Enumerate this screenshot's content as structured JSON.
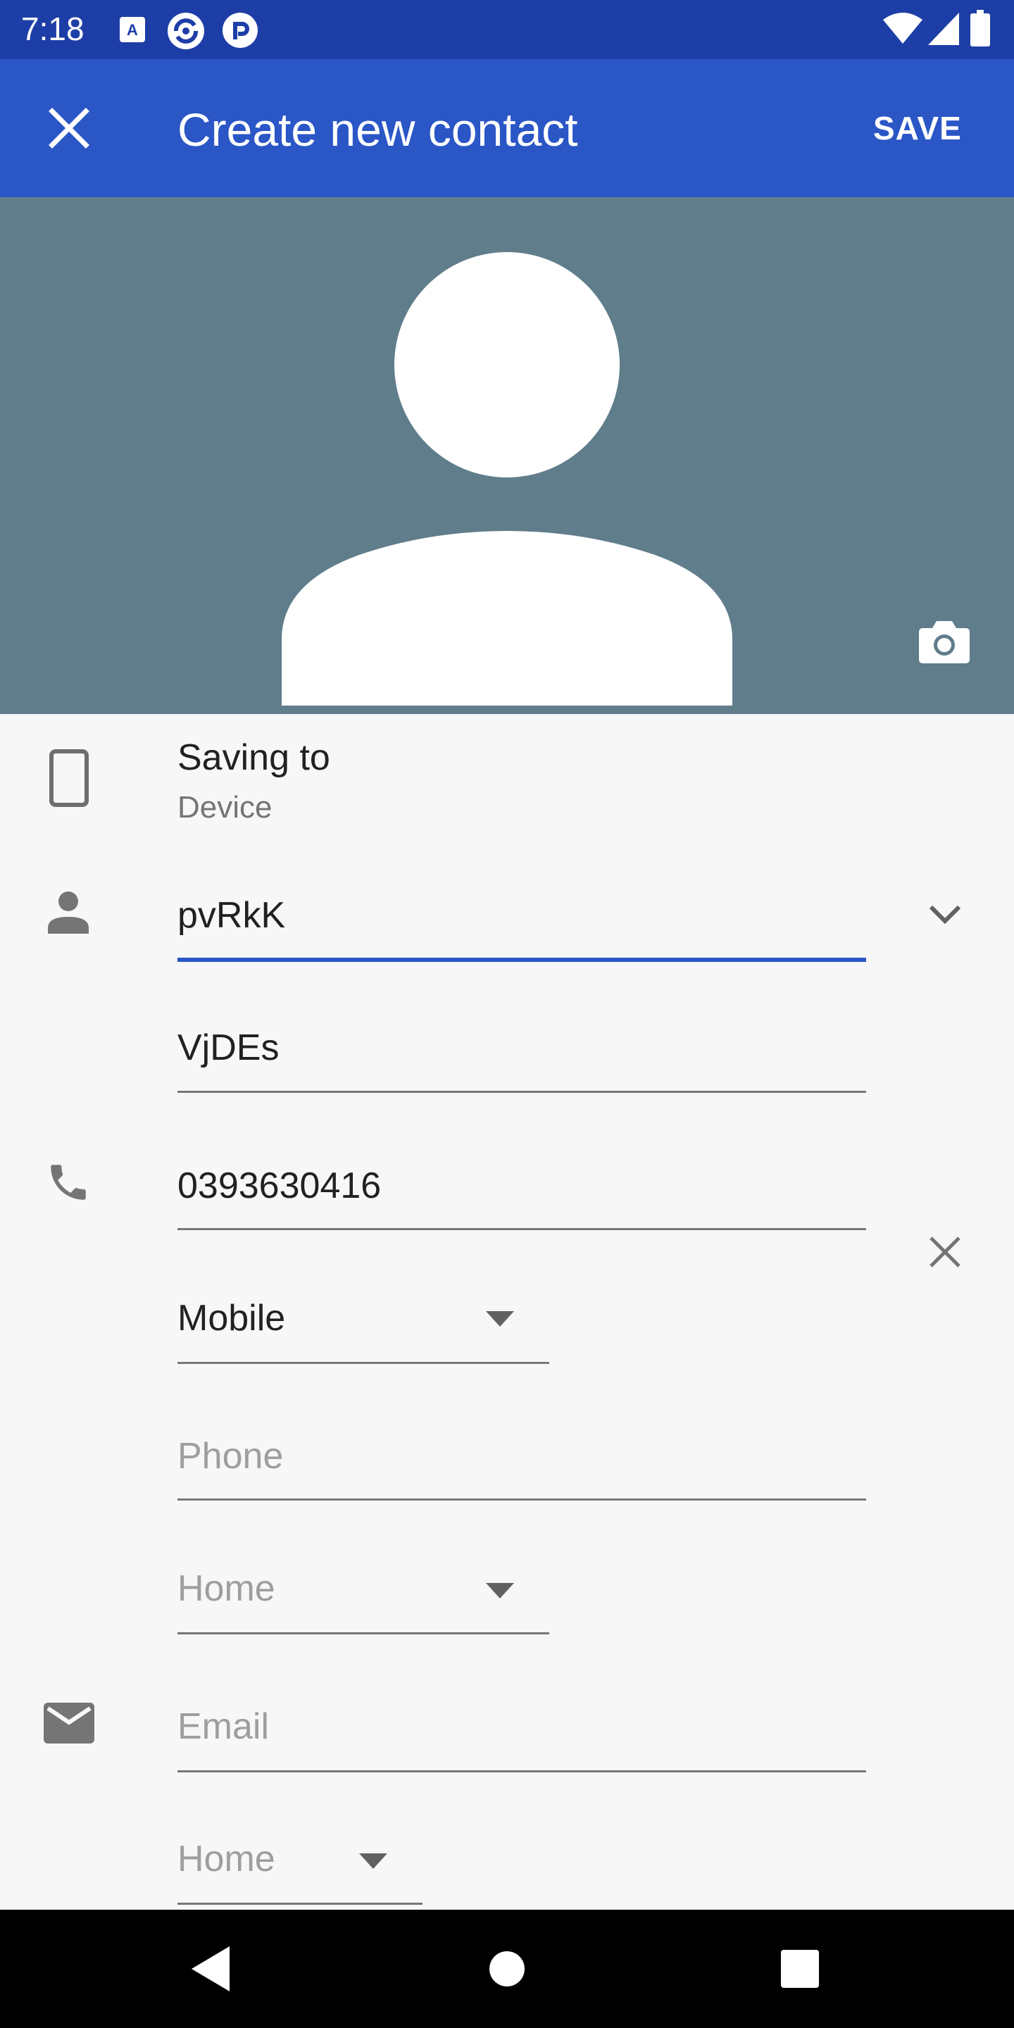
{
  "status_bar": {
    "time": "7:18",
    "left_icons": [
      "a-keyboard-icon",
      "sync-app-icon",
      "app-r-icon"
    ],
    "right_icons": [
      "wifi-icon",
      "signal-icon",
      "battery-icon"
    ]
  },
  "app_bar": {
    "close_icon": "close-icon",
    "title": "Create new contact",
    "save_label": "SAVE"
  },
  "photo": {
    "avatar_icon": "person-silhouette-icon",
    "camera_icon": "camera-icon"
  },
  "account": {
    "label": "Saving to",
    "value": "Device"
  },
  "name": {
    "first": "pvRkK",
    "last": "VjDEs"
  },
  "phone": {
    "number": "0393630416",
    "type": "Mobile",
    "new_placeholder": "Phone",
    "new_type": "Home"
  },
  "email": {
    "placeholder": "Email",
    "type": "Home"
  },
  "colors": {
    "status_bar": "#1e3ea7",
    "app_bar": "#2a56c6",
    "photo_bg": "#607d8b",
    "accent": "#2a56c6",
    "background": "#f7f7f7"
  }
}
